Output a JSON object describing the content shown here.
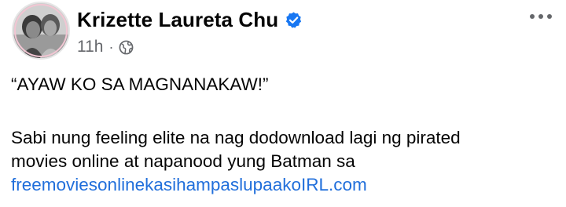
{
  "post": {
    "author": {
      "name": "Krizette Laureta Chu",
      "verified": true,
      "icon": "verified-badge-icon"
    },
    "meta": {
      "time": "11h",
      "separator": "·",
      "audience_icon": "globe-icon"
    },
    "more_icon": "more-options-icon",
    "text": {
      "quote": "“AYAW KO SA MAGNANAKAW!”",
      "line1": "Sabi nung feeling elite na nag dodownload lagi ng pirated",
      "line2": "movies online at napanood yung Batman sa",
      "link": "freemoviesonlinekasihampaslupaakoIRL.com"
    },
    "colors": {
      "link": "#216fdb",
      "verified": "#1877f2",
      "meta": "#65676b",
      "text": "#050505"
    }
  }
}
